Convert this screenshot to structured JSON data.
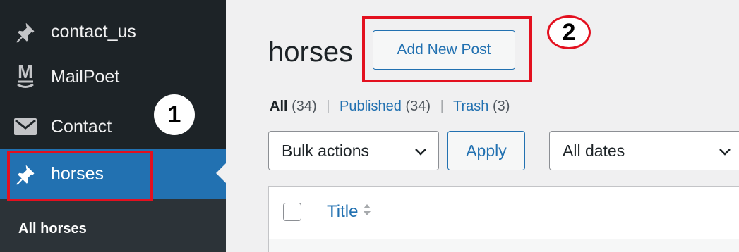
{
  "sidebar": {
    "items": [
      {
        "label": "contact_us",
        "icon": "pushpin-icon"
      },
      {
        "label": "MailPoet",
        "icon": "mailpoet-icon"
      },
      {
        "label": "Contact",
        "icon": "envelope-icon"
      },
      {
        "label": "horses",
        "icon": "pushpin-icon",
        "active": true
      }
    ],
    "submenu": {
      "all_label": "All horses"
    }
  },
  "main": {
    "title": "horses",
    "add_new_label": "Add New Post",
    "filters": {
      "all_label": "All",
      "all_count": "(34)",
      "published_label": "Published",
      "published_count": "(34)",
      "trash_label": "Trash",
      "trash_count": "(3)",
      "separator": "|"
    },
    "bulk_select_value": "Bulk actions",
    "apply_label": "Apply",
    "date_select_value": "All dates",
    "table": {
      "title_column": "Title"
    }
  },
  "annotations": {
    "marker_1": "1",
    "marker_2": "2"
  },
  "colors": {
    "sidebar_bg": "#1d2327",
    "active_bg": "#2271b1",
    "accent": "#2271b1",
    "highlight": "#e3101f"
  }
}
